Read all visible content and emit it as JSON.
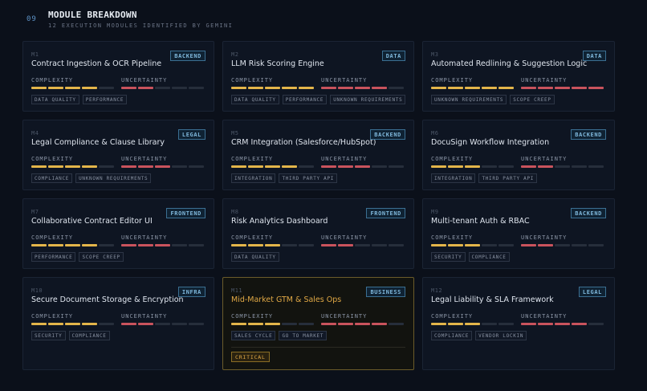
{
  "header": {
    "section_number": "09",
    "title": "MODULE BREAKDOWN",
    "subtitle": "12 EXECUTION MODULES IDENTIFIED BY GEMINI"
  },
  "labels": {
    "complexity": "COMPLEXITY",
    "uncertainty": "UNCERTAINTY"
  },
  "colors": {
    "complexity_bar": "#e3b54a",
    "uncertainty_bar": "#c9535d",
    "badge": "#7fb8dc",
    "critical": "#e0a845"
  },
  "modules": [
    {
      "id": "M1",
      "title": "Contract Ingestion & OCR Pipeline",
      "category": "BACKEND",
      "complexity": 4,
      "uncertainty": 2,
      "tags": [
        "DATA QUALITY",
        "PERFORMANCE"
      ]
    },
    {
      "id": "M2",
      "title": "LLM Risk Scoring Engine",
      "category": "DATA",
      "complexity": 5,
      "uncertainty": 4,
      "tags": [
        "DATA QUALITY",
        "PERFORMANCE",
        "UNKNOWN REQUIREMENTS"
      ]
    },
    {
      "id": "M3",
      "title": "Automated Redlining & Suggestion Logic",
      "category": "DATA",
      "complexity": 5,
      "uncertainty": 5,
      "tags": [
        "UNKNOWN REQUIREMENTS",
        "SCOPE CREEP"
      ]
    },
    {
      "id": "M4",
      "title": "Legal Compliance & Clause Library",
      "category": "LEGAL",
      "complexity": 4,
      "uncertainty": 3,
      "tags": [
        "COMPLIANCE",
        "UNKNOWN REQUIREMENTS"
      ]
    },
    {
      "id": "M5",
      "title": "CRM Integration (Salesforce/HubSpot)",
      "category": "BACKEND",
      "complexity": 4,
      "uncertainty": 3,
      "tags": [
        "INTEGRATION",
        "THIRD PARTY API"
      ]
    },
    {
      "id": "M6",
      "title": "DocuSign Workflow Integration",
      "category": "BACKEND",
      "complexity": 3,
      "uncertainty": 2,
      "tags": [
        "INTEGRATION",
        "THIRD PARTY API"
      ]
    },
    {
      "id": "M7",
      "title": "Collaborative Contract Editor UI",
      "category": "FRONTEND",
      "complexity": 4,
      "uncertainty": 3,
      "tags": [
        "PERFORMANCE",
        "SCOPE CREEP"
      ]
    },
    {
      "id": "M8",
      "title": "Risk Analytics Dashboard",
      "category": "FRONTEND",
      "complexity": 3,
      "uncertainty": 2,
      "tags": [
        "DATA QUALITY"
      ]
    },
    {
      "id": "M9",
      "title": "Multi-tenant Auth & RBAC",
      "category": "BACKEND",
      "complexity": 3,
      "uncertainty": 2,
      "tags": [
        "SECURITY",
        "COMPLIANCE"
      ]
    },
    {
      "id": "M10",
      "title": "Secure Document Storage & Encryption",
      "category": "INFRA",
      "complexity": 4,
      "uncertainty": 2,
      "tags": [
        "SECURITY",
        "COMPLIANCE"
      ]
    },
    {
      "id": "M11",
      "title": "Mid-Market GTM & Sales Ops",
      "category": "BUSINESS",
      "complexity": 3,
      "uncertainty": 4,
      "tags": [
        "SALES CYCLE",
        "GO TO MARKET"
      ],
      "critical": true,
      "critical_label": "CRITICAL"
    },
    {
      "id": "M12",
      "title": "Legal Liability & SLA Framework",
      "category": "LEGAL",
      "complexity": 3,
      "uncertainty": 4,
      "tags": [
        "COMPLIANCE",
        "VENDOR LOCKIN"
      ]
    }
  ]
}
